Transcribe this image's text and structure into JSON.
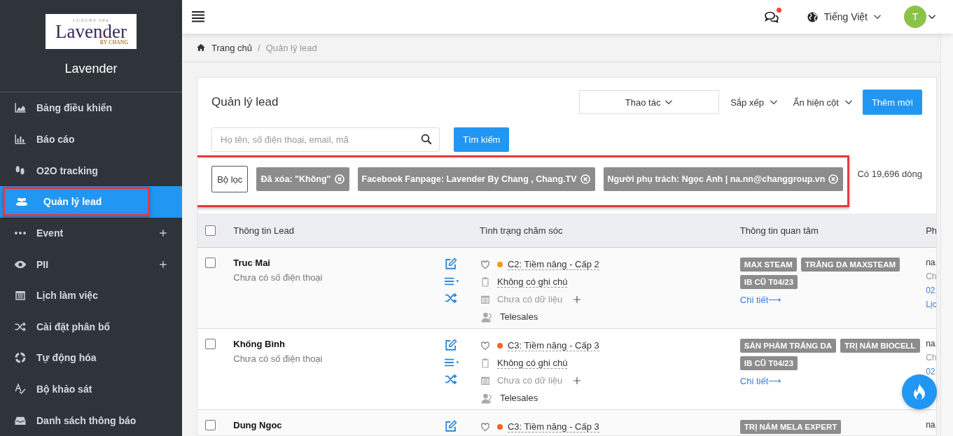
{
  "brand": {
    "logo_top": "LUXURY SPA",
    "logo_main": "Lavender",
    "logo_by": "BY",
    "logo_bottom": "CHANG",
    "name": "Lavender"
  },
  "sidebar": {
    "items": [
      {
        "label": "Bảng điều khiển",
        "kind": "area-chart",
        "selected": false,
        "expandable": false,
        "highlighted": false
      },
      {
        "label": "Báo cáo",
        "kind": "bar-chart",
        "selected": false,
        "expandable": false,
        "highlighted": false
      },
      {
        "label": "O2O tracking",
        "kind": "footprints",
        "selected": false,
        "expandable": false,
        "highlighted": false
      },
      {
        "label": "Quản lý lead",
        "kind": "users",
        "selected": true,
        "expandable": false,
        "highlighted": true
      },
      {
        "label": "Event",
        "kind": "dots",
        "selected": false,
        "expandable": true,
        "highlighted": false
      },
      {
        "label": "PII",
        "kind": "eye",
        "selected": false,
        "expandable": true,
        "highlighted": false
      },
      {
        "label": "Lịch làm việc",
        "kind": "calendar",
        "selected": false,
        "expandable": false,
        "highlighted": false
      },
      {
        "label": "Cài đặt phân bổ",
        "kind": "shuffle",
        "selected": false,
        "expandable": false,
        "highlighted": false
      },
      {
        "label": "Tự động hóa",
        "kind": "ring",
        "selected": false,
        "expandable": false,
        "highlighted": false
      },
      {
        "label": "Bộ khảo sát",
        "kind": "spellcheck",
        "selected": false,
        "expandable": false,
        "highlighted": false
      },
      {
        "label": "Danh sách thông báo",
        "kind": "inbox",
        "selected": false,
        "expandable": false,
        "highlighted": false
      }
    ]
  },
  "header": {
    "notification": true,
    "language": "Tiếng Việt",
    "avatar": "T"
  },
  "breadcrumb_separator": "/",
  "breadcrumb": [
    {
      "label": "Trang chủ",
      "current": false
    },
    {
      "label": "Quản lý lead",
      "current": true
    }
  ],
  "panel": {
    "title": "Quản lý lead",
    "action_dropdown": "Thao tác",
    "sort": "Sắp xếp",
    "columns_toggle": "Ẩn hiện cột",
    "add_button": "Thêm mới",
    "search": {
      "placeholder": "Họ tên, số điện thoại, email, mã"
    },
    "search_button": "Tìm kiếm",
    "filter_button": "Bộ lọc",
    "filters_highlighted": true,
    "filters": [
      "Đã xóa: \"Không\"",
      "Facebook Fanpage: Lavender By Chang , Chang.TV",
      "Người phụ trách: Ngọc Anh | na.nn@changgroup.vn"
    ],
    "count": "Có 19,696 dòng"
  },
  "table": {
    "select_all": {
      "checked": false
    },
    "columns": [
      "Thông tin Lead",
      "Tình trạng chăm sóc",
      "Thông tin quan tâm",
      "Ph"
    ],
    "rows": [
      {
        "checked": false,
        "name": "Truc Mai",
        "phone": "Chưa có số điện thoại",
        "status": "C2: Tiềm năng - Cấp 2",
        "color": "#f39c12",
        "note": "Không có ghi chú",
        "schedule": "Chưa có dữ liệu",
        "assignee": "Telesales",
        "tags": [
          "MAX STEAM",
          "TRẮNG DA MAXSTEAM",
          "IB CŨ T04/23"
        ],
        "detail": "Chi tiết⟶",
        "column_4": [
          {
            "text": "na.",
            "kind": "text"
          },
          {
            "text": "Ch",
            "kind": "muted"
          },
          {
            "text": "02,",
            "kind": "link"
          },
          {
            "text": "Lịc",
            "kind": "link"
          }
        ]
      },
      {
        "checked": false,
        "name": "Khống Bình",
        "phone": "Chưa có số điện thoại",
        "status": "C3: Tiềm năng - Cấp 3",
        "color": "#f26522",
        "note": "Không có ghi chú",
        "schedule": "Chưa có dữ liệu",
        "assignee": "Telesales",
        "tags": [
          "SẢN PHẨM TRẮNG DA",
          "TRỊ NÁM BIOCELL",
          "IB CŨ T04/23"
        ],
        "detail": "Chi tiết⟶",
        "column_4": [
          {
            "text": "na.",
            "kind": "text"
          },
          {
            "text": "Ch",
            "kind": "muted"
          },
          {
            "text": "02,",
            "kind": "link"
          }
        ]
      },
      {
        "checked": false,
        "name": "Dung Ngoc",
        "status": "C3: Tiềm năng - Cấp 3",
        "color": "#f26522",
        "tags": [
          "TRỊ NÁM MELA EXPERT"
        ],
        "column_4": [
          {
            "text": "na.",
            "kind": "text"
          }
        ]
      }
    ]
  }
}
